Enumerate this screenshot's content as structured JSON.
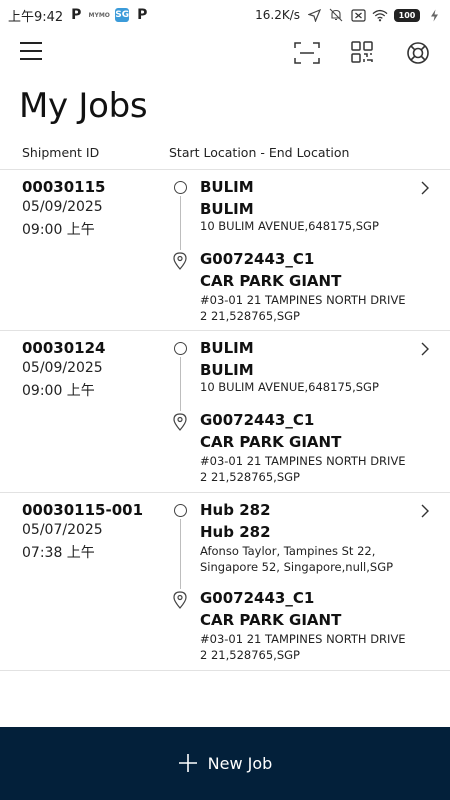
{
  "status_bar": {
    "time": "上午9:42",
    "app_icons": [
      "P",
      "MYMO",
      "SG",
      "P"
    ],
    "network_speed": "16.2K/s",
    "battery": "100"
  },
  "header": {
    "title": "My Jobs",
    "icons": [
      "menu-icon",
      "scan-icon",
      "qr-code-icon",
      "help-icon"
    ]
  },
  "table": {
    "col_shipment": "Shipment ID",
    "col_location": "Start Location - End Location"
  },
  "jobs": [
    {
      "id": "00030115",
      "date": "05/09/2025",
      "time": "09:00 上午",
      "start_name": "BULIM",
      "start_name2": "BULIM",
      "start_address": "10 BULIM AVENUE,648175,SGP",
      "end_name": "G0072443_C1",
      "end_name2": "CAR PARK GIANT",
      "end_address": "#03-01 21 TAMPINES NORTH DRIVE 2 21,528765,SGP"
    },
    {
      "id": "00030124",
      "date": "05/09/2025",
      "time": "09:00 上午",
      "start_name": "BULIM",
      "start_name2": "BULIM",
      "start_address": "10 BULIM AVENUE,648175,SGP",
      "end_name": "G0072443_C1",
      "end_name2": "CAR PARK GIANT",
      "end_address": "#03-01 21 TAMPINES NORTH DRIVE 2 21,528765,SGP"
    },
    {
      "id": "00030115-001",
      "date": "05/07/2025",
      "time": "07:38 上午",
      "start_name": "Hub 282",
      "start_name2": "Hub 282",
      "start_address": "Afonso Taylor, Tampines St 22, Singapore 52, Singapore,null,SGP",
      "end_name": "G0072443_C1",
      "end_name2": "CAR PARK GIANT",
      "end_address": "#03-01 21 TAMPINES NORTH DRIVE 2 21,528765,SGP"
    }
  ],
  "footer": {
    "new_job_label": "New Job",
    "background": "#03203a"
  }
}
